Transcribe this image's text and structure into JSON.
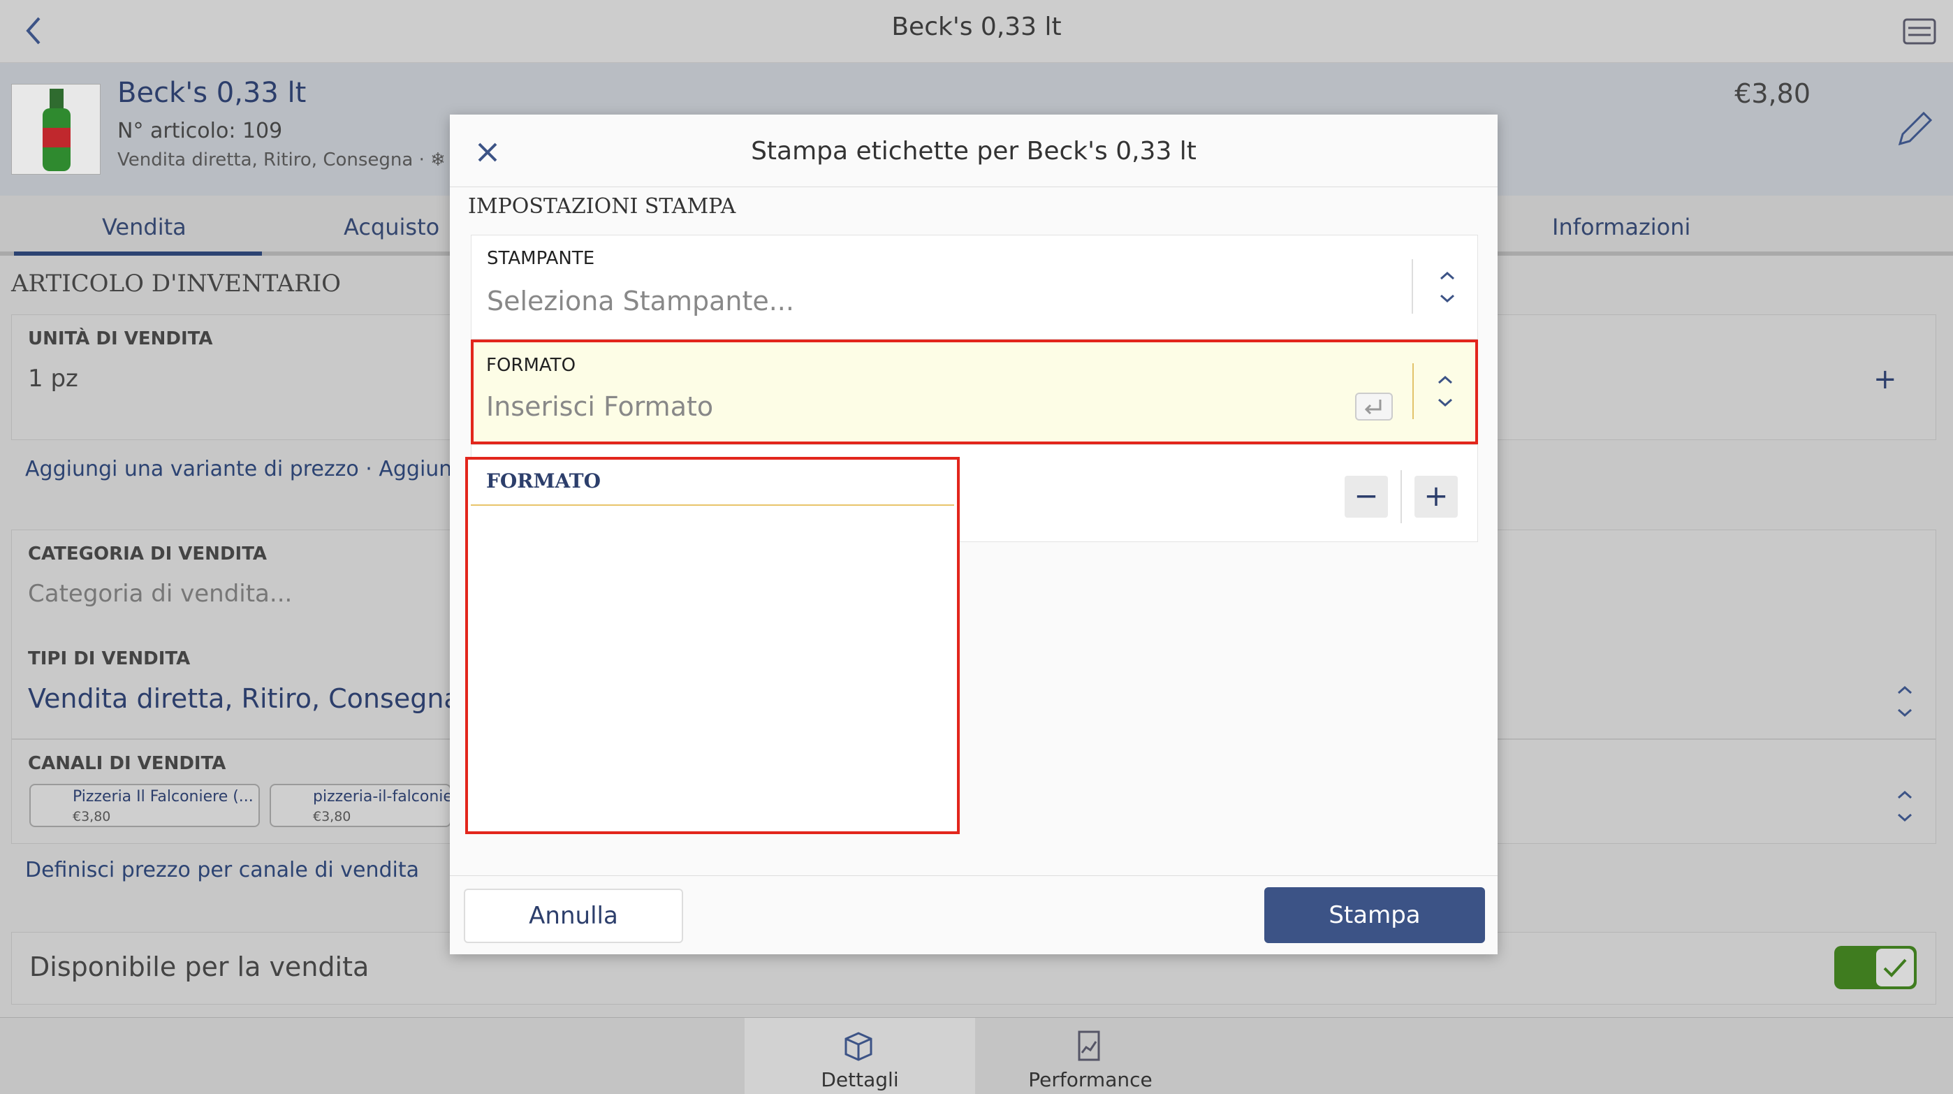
{
  "topbar": {
    "title": "Beck's 0,33 lt"
  },
  "product": {
    "name": "Beck's 0,33 lt",
    "article_number": "N° articolo: 109",
    "sales_types": "Vendita diretta, Ritiro, Consegna · ❄ P",
    "price": "€3,80"
  },
  "tabs": [
    "Vendita",
    "Acquisto",
    "Informazioni"
  ],
  "inventory": {
    "section_title": "ARTICOLO D'INVENTARIO",
    "unit_label": "UNITÀ DI VENDITA",
    "unit_value": "1 pz",
    "add_variant_link": "Aggiungi una variante di prezzo · Aggiungi un",
    "category_label": "CATEGORIA DI VENDITA",
    "category_placeholder": "Categoria di vendita...",
    "types_label": "TIPI DI VENDITA",
    "types_value": "Vendita diretta, Ritiro, Consegna",
    "channels_label": "CANALI DI VENDITA",
    "channels": [
      {
        "name": "Pizzeria Il Falconiere (...",
        "price": "€3,80"
      },
      {
        "name": "pizzeria-il-falconiere",
        "price": "€3,80"
      }
    ],
    "channel_price_link": "Definisci prezzo per canale di vendita",
    "available_label": "Disponibile per la vendita"
  },
  "bottom_nav": [
    {
      "label": "Dettagli",
      "icon": "box-icon"
    },
    {
      "label": "Performance",
      "icon": "chart-icon"
    }
  ],
  "modal": {
    "title": "Stampa etichette per Beck's 0,33 lt",
    "settings_title": "IMPOSTAZIONI STAMPA",
    "printer_label": "STAMPANTE",
    "printer_placeholder": "Seleziona Stampante...",
    "format_label": "FORMATO",
    "format_placeholder": "Inserisci Formato",
    "dropdown_title": "FORMATO",
    "cancel_label": "Annulla",
    "print_label": "Stampa"
  },
  "colors": {
    "accent": "#3c5386",
    "highlight_border": "#e2261c",
    "toggle_on": "#3f7c1f"
  }
}
